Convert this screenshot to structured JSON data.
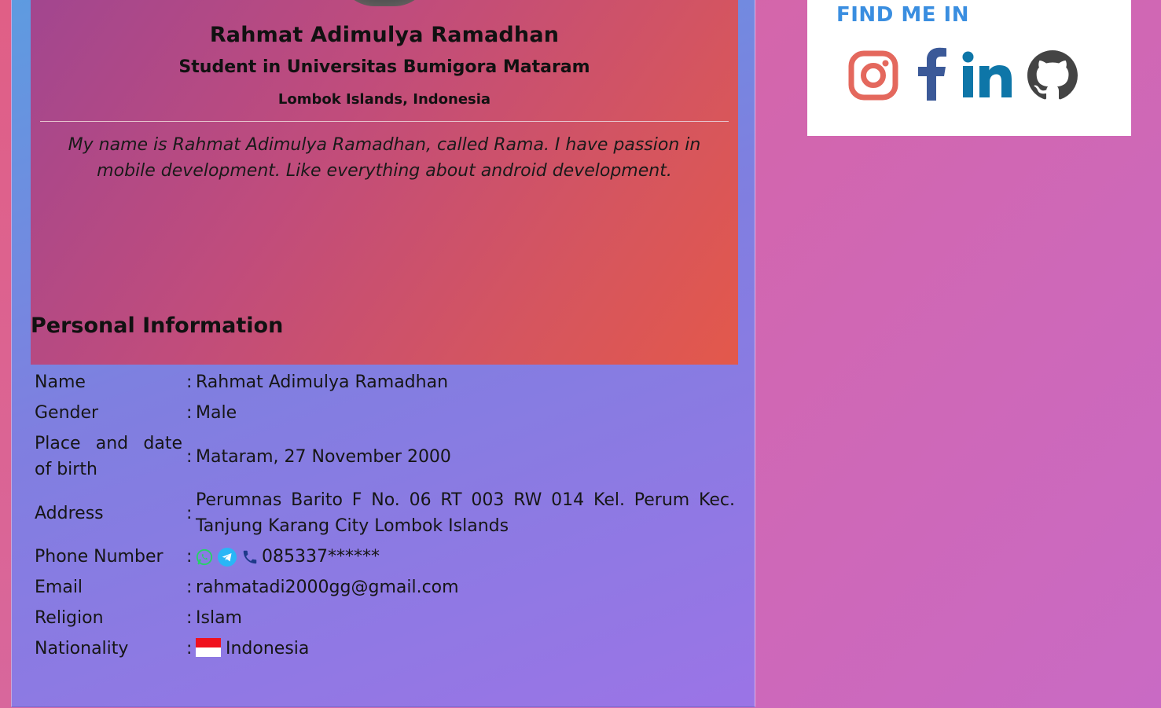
{
  "profile": {
    "name": "Rahmat Adimulya Ramadhan",
    "subtitle": "Student in Universitas Bumigora Mataram",
    "location": "Lombok Islands, Indonesia",
    "bio": "My name is Rahmat Adimulya Ramadhan, called Rama. I have passion in mobile development. Like everything about android development."
  },
  "personal": {
    "heading": "Personal Information",
    "separator": ":",
    "rows": [
      {
        "label": "Name",
        "value": "Rahmat Adimulya Ramadhan"
      },
      {
        "label": "Gender",
        "value": "Male"
      },
      {
        "label": "Place and date of birth",
        "value": "Mataram, 27 November 2000"
      },
      {
        "label": "Address",
        "value": "Perumnas Barito F No. 06 RT 003 RW 014 Kel. Perum Kec. Tanjung Karang City Lombok Islands"
      },
      {
        "label": "Phone Number",
        "value": "085337******",
        "icons": [
          "whatsapp-icon",
          "telegram-icon",
          "phone-icon"
        ]
      },
      {
        "label": "Email",
        "value": "rahmatadi2000gg@gmail.com"
      },
      {
        "label": "Religion",
        "value": "Islam"
      },
      {
        "label": "Nationality",
        "value": "Indonesia",
        "icon": "indonesia-flag-icon"
      }
    ]
  },
  "social": {
    "heading": "FIND ME IN",
    "links": [
      {
        "name": "instagram-icon",
        "color": "#e4685d"
      },
      {
        "name": "facebook-icon",
        "color": "#3b5998"
      },
      {
        "name": "linkedin-icon",
        "color": "#0e76a8"
      },
      {
        "name": "github-icon",
        "color": "#444444"
      }
    ]
  },
  "colors": {
    "accent": "#3a8ee0",
    "whatsapp": "#25d366",
    "telegram": "#29b6f6",
    "phone": "#1e3a8a",
    "flag_red": "#f0111d"
  }
}
